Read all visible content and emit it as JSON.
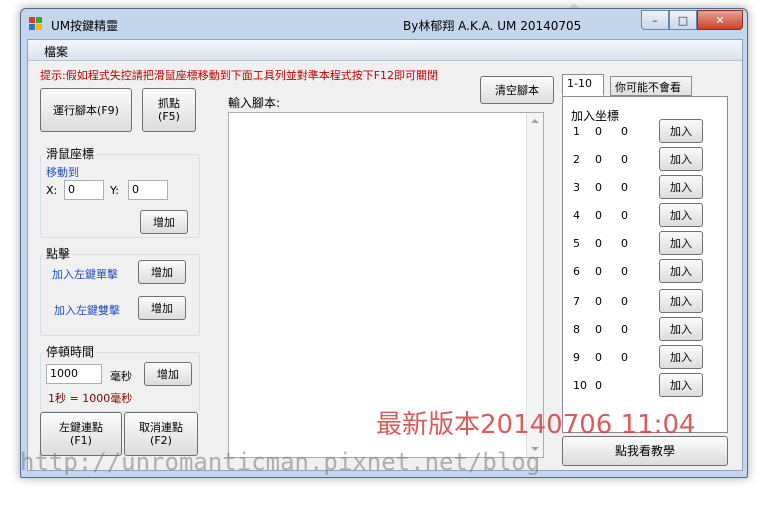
{
  "window": {
    "title": "UM按鍵精靈",
    "byline": "By林郁翔 A.K.A.  UM  20140705",
    "caption": {
      "minimize": "–",
      "maximize": "□",
      "close": "✕"
    }
  },
  "menu": {
    "file": "檔案"
  },
  "hint": "提示:假如程式失控請把滑鼠座標移動到下面工具列並對準本程式按下F12即可關閉",
  "buttons": {
    "run_script": "運行腳本(F9)",
    "capture_point": "抓點\n(F5)",
    "clear_script": "清空腳本",
    "left_repeat": "左鍵連點\n(F1)",
    "cancel_repeat": "取消連點\n(F2)",
    "tutorial": "點我看教學"
  },
  "mouse_group": {
    "label": "滑鼠座標",
    "move_to": "移動到",
    "x_label": "X:",
    "x_value": "0",
    "y_label": "Y:",
    "y_value": "0",
    "add": "增加"
  },
  "click_group": {
    "label": "點擊",
    "left_single": "加入左鍵單擊",
    "left_double": "加入左鍵雙擊",
    "add": "增加"
  },
  "pause_group": {
    "label": "停頓時間",
    "value": "1000",
    "unit": "毫秒",
    "add": "增加",
    "note": "1秒 = 1000毫秒"
  },
  "script": {
    "label": "輸入腳本:",
    "content": ""
  },
  "tabs": [
    {
      "label": "1-10",
      "active": true
    },
    {
      "label": "你可能不會看",
      "active": false
    }
  ],
  "coords_panel": {
    "title": "加入坐標",
    "add_label": "加入",
    "rows": [
      {
        "index": "1",
        "x": "0",
        "y": "0"
      },
      {
        "index": "2",
        "x": "0",
        "y": "0"
      },
      {
        "index": "3",
        "x": "0",
        "y": "0"
      },
      {
        "index": "4",
        "x": "0",
        "y": "0"
      },
      {
        "index": "5",
        "x": "0",
        "y": "0"
      },
      {
        "index": "6",
        "x": "0",
        "y": "0"
      },
      {
        "index": "7",
        "x": "0",
        "y": "0"
      },
      {
        "index": "8",
        "x": "0",
        "y": "0"
      },
      {
        "index": "9",
        "x": "0",
        "y": "0"
      },
      {
        "index": "10",
        "x": "0",
        "y": ""
      }
    ]
  },
  "watermarks": {
    "url": "http://unromanticman.pixnet.net/blog",
    "version": "最新版本20140706 11:04",
    "logo": "UM"
  }
}
